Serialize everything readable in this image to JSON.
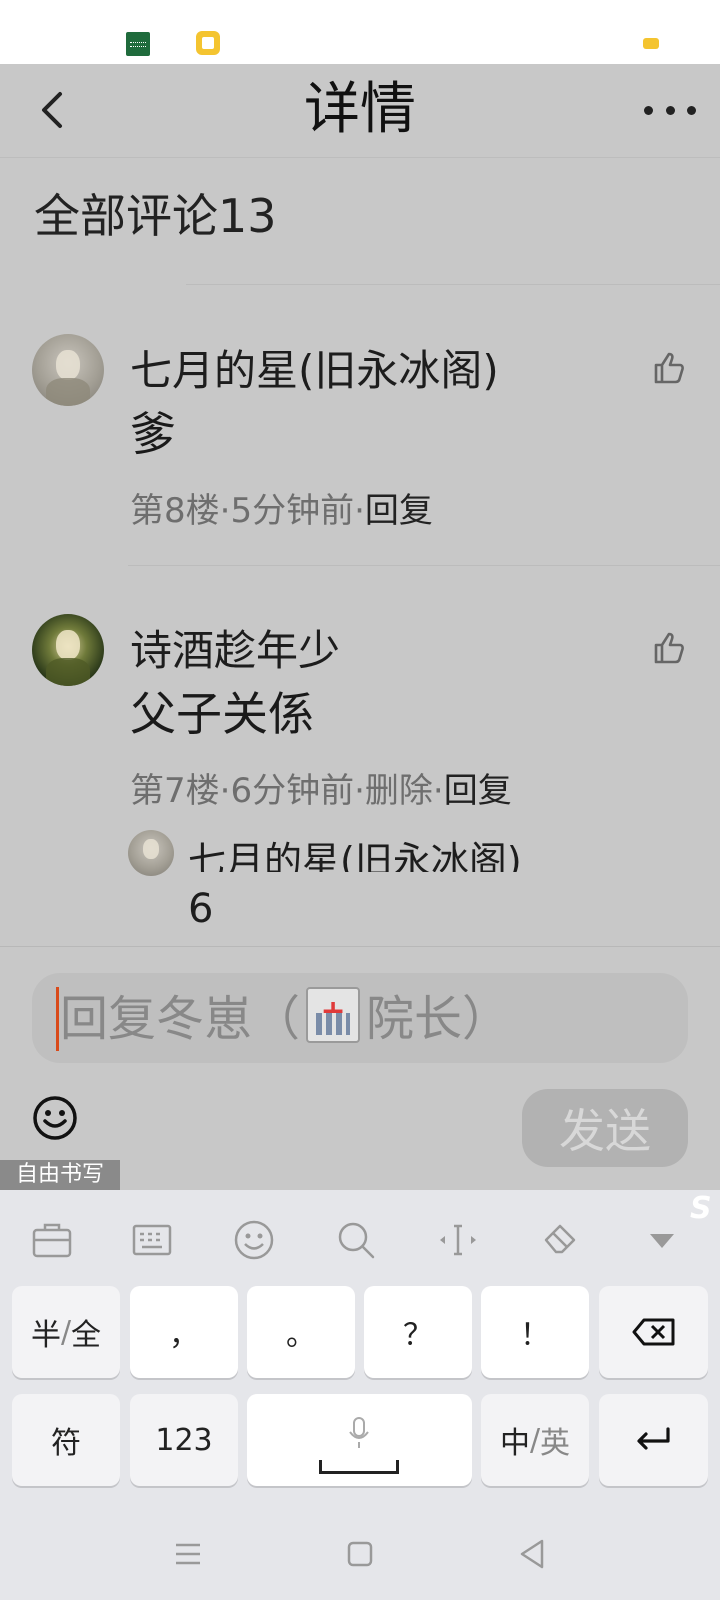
{
  "header": {
    "title": "详情",
    "back_icon": "chevron-left-icon",
    "more_icon": "more-horizontal-icon"
  },
  "comments_header": {
    "label": "全部评论13"
  },
  "comments": [
    {
      "author": "七月的星(旧永冰阁)",
      "text": "爹",
      "floor": "第8楼",
      "sep1": "·",
      "time": "5分钟前",
      "sep2": "·",
      "reply": "回复"
    },
    {
      "author": "诗酒趁年少",
      "text": "父子关係",
      "floor": "第7楼",
      "sep1": "·",
      "time": "6分钟前",
      "sep2": "·",
      "delete": "删除",
      "sep3": "·",
      "reply": "回复",
      "sub_reply": {
        "author": "七月的星(旧永冰阁)",
        "text": "6"
      }
    }
  ],
  "input": {
    "placeholder_prefix": "回复冬崽（",
    "placeholder_emoji": "hospital-emoji",
    "placeholder_suffix": "院长）",
    "send_label": "发送",
    "emoji_icon": "smiley-icon"
  },
  "handwrite": {
    "label": "自由书写"
  },
  "keyboard": {
    "toolbar_icons": [
      "toolbox-icon",
      "keyboard-icon",
      "emoji-icon",
      "search-icon",
      "cursor-icon",
      "clear-icon",
      "collapse-icon"
    ],
    "row1": [
      "半/全",
      "，",
      "。",
      "？",
      "！"
    ],
    "row2_symbol": "符",
    "row2_num": "123",
    "row2_lang_a": "中",
    "row2_lang_sep": "/",
    "row2_lang_b": "英",
    "half_a": "半",
    "half_sep": "/",
    "half_b": "全"
  },
  "system_nav": {
    "icons": [
      "menu-icon",
      "home-icon",
      "back-icon"
    ]
  },
  "colors": {
    "overlay": "#c8c8c8",
    "caret": "#d94a1a",
    "keyboard_bg": "#e5e6ea",
    "status_accent": "#f4c430"
  }
}
